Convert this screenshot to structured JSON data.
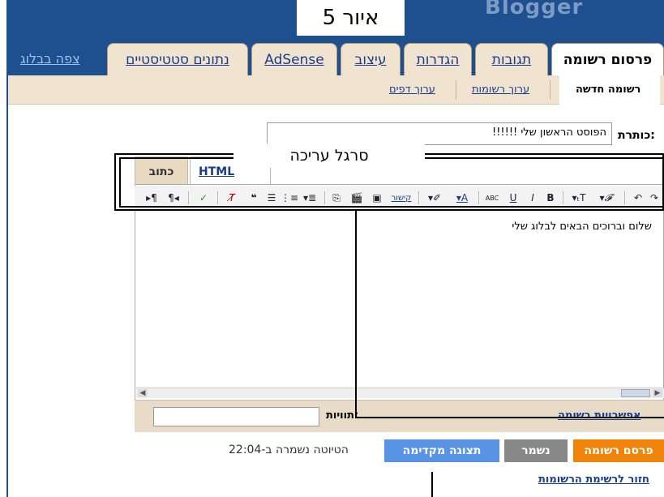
{
  "figure": {
    "caption": "איור 5"
  },
  "header": {
    "brand": "Blogger"
  },
  "tabs": [
    {
      "label": "פרסום רשומה"
    },
    {
      "label": "תגובות"
    },
    {
      "label": "הגדרות"
    },
    {
      "label": "עיצוב"
    },
    {
      "label": "AdSense"
    },
    {
      "label": "נתונים סטטיסטיים"
    }
  ],
  "view_blog": "צפה בבלוג",
  "subtabs": [
    {
      "label": "רשומה חדשה"
    },
    {
      "label": "ערוך רשומות"
    },
    {
      "label": "ערוך דפים"
    }
  ],
  "title_field": {
    "label": "כותרת:",
    "value": "הפוסט הראשון שלי !!!!!!"
  },
  "editor": {
    "mode_tabs": {
      "compose": "כתוב",
      "html": "HTML"
    },
    "toolbar_link": "קישור",
    "body": "שלום וברוכים הבאים לבלוג שלי"
  },
  "footer": {
    "labels_label": "תוויות:",
    "post_options": "אפשרויות רשומה"
  },
  "actions": {
    "publish": "פרסם רשומה",
    "saved": "נשמר",
    "preview": "תצוגה מקדימה",
    "draft_status": "הטיוטה נשמרה ב-22:04",
    "back_link": "חזור לרשימת הרשומות"
  },
  "callout": {
    "label": "סרגל עריכה"
  },
  "colors": {
    "nav": "#1e4f8f",
    "publish": "#f0830a",
    "preview": "#5893e6",
    "saved": "#888888"
  }
}
